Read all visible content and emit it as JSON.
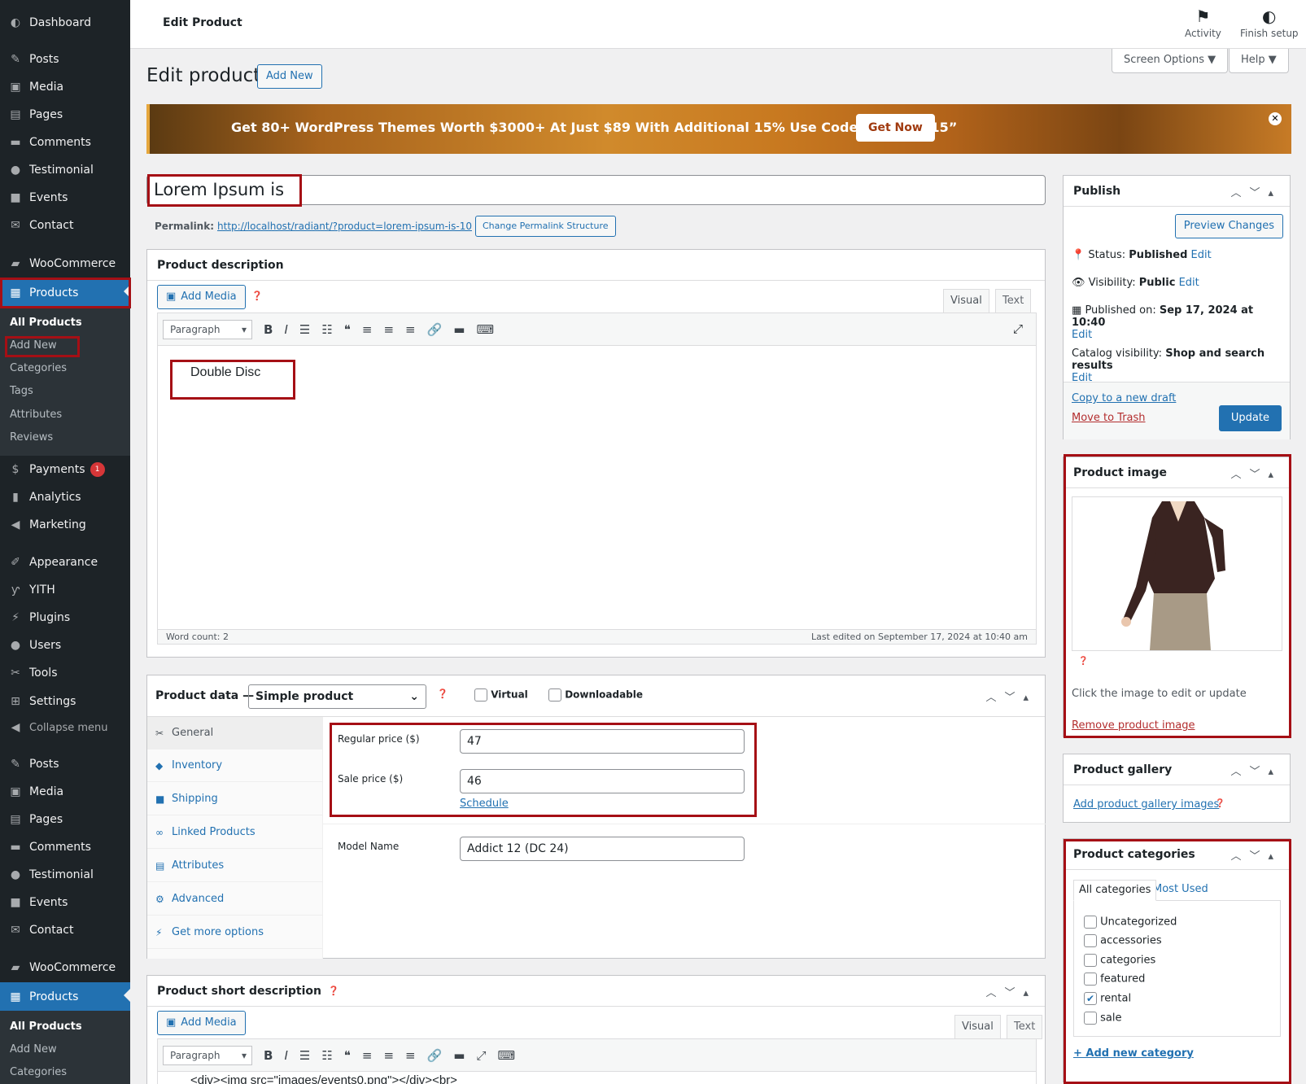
{
  "sidebar": {
    "items": [
      {
        "label": "Dashboard",
        "icon": "dashboard-icon"
      },
      {
        "label": "Posts",
        "icon": "pin-icon"
      },
      {
        "label": "Media",
        "icon": "media-icon"
      },
      {
        "label": "Pages",
        "icon": "pages-icon"
      },
      {
        "label": "Comments",
        "icon": "comments-icon"
      },
      {
        "label": "Testimonial",
        "icon": "user-icon"
      },
      {
        "label": "Events",
        "icon": "video-icon"
      },
      {
        "label": "Contact",
        "icon": "mail-icon"
      },
      {
        "label": "WooCommerce",
        "icon": "woo-icon"
      },
      {
        "label": "Products",
        "icon": "archive-icon"
      }
    ],
    "products_submenu": [
      "All Products",
      "Add New",
      "Categories",
      "Tags",
      "Attributes",
      "Reviews"
    ],
    "items2": [
      {
        "label": "Payments",
        "icon": "dollar-icon"
      },
      {
        "label": "Analytics",
        "icon": "chart-icon"
      },
      {
        "label": "Marketing",
        "icon": "megaphone-icon"
      },
      {
        "label": "Appearance",
        "icon": "brush-icon"
      },
      {
        "label": "YITH",
        "icon": "yith-icon"
      },
      {
        "label": "Plugins",
        "icon": "plug-icon"
      },
      {
        "label": "Users",
        "icon": "user-icon"
      },
      {
        "label": "Tools",
        "icon": "wrench-icon"
      },
      {
        "label": "Settings",
        "icon": "settings-icon"
      },
      {
        "label": "Collapse menu",
        "icon": "collapse-icon"
      },
      {
        "label": "Posts",
        "icon": "pin-icon"
      },
      {
        "label": "Media",
        "icon": "media-icon"
      },
      {
        "label": "Pages",
        "icon": "pages-icon"
      },
      {
        "label": "Comments",
        "icon": "comments-icon"
      },
      {
        "label": "Testimonial",
        "icon": "user-icon"
      },
      {
        "label": "Events",
        "icon": "video-icon"
      },
      {
        "label": "Contact",
        "icon": "mail-icon"
      },
      {
        "label": "WooCommerce",
        "icon": "woo-icon"
      },
      {
        "label": "Products",
        "icon": "archive-icon"
      }
    ],
    "payments_badge": "1",
    "products_submenu2": [
      "All Products",
      "Add New",
      "Categories"
    ]
  },
  "topbar": {
    "title": "Edit Product",
    "activity": "Activity",
    "finish_setup": "Finish setup"
  },
  "screen_options": "Screen Options ▼",
  "help": "Help ▼",
  "page_title": "Edit product",
  "add_new": "Add New",
  "promo": {
    "text": "Get 80+ WordPress Themes Worth $3000+ At Just $89 With Additional 15% Use Code “MagBun15”",
    "button": "Get Now"
  },
  "post_title": "Lorem Ipsum is",
  "permalink": {
    "label": "Permalink:",
    "url": "http://localhost/radiant/?product=lorem-ipsum-is-10",
    "button": "Change Permalink Structure"
  },
  "description": {
    "heading": "Product description",
    "add_media": "Add Media",
    "tab_visual": "Visual",
    "tab_text": "Text",
    "format": "Paragraph",
    "content": "Double Disc",
    "word_count": "Word count: 2",
    "last_edited": "Last edited on September 17, 2024 at 10:40 am"
  },
  "product_data": {
    "heading": "Product data —",
    "type": "Simple product",
    "virtual": "Virtual",
    "downloadable": "Downloadable",
    "tabs": [
      "General",
      "Inventory",
      "Shipping",
      "Linked Products",
      "Attributes",
      "Advanced",
      "Get more options"
    ],
    "regular_price_label": "Regular price ($)",
    "regular_price": "47",
    "sale_price_label": "Sale price ($)",
    "sale_price": "46",
    "schedule": "Schedule",
    "model_name_label": "Model Name",
    "model_name": "Addict 12 (DC 24)"
  },
  "short_description": {
    "heading": "Product short description",
    "add_media": "Add Media",
    "tab_visual": "Visual",
    "tab_text": "Text",
    "format": "Paragraph",
    "content": "<div><img src=\"images/events0.png\"></div><br>"
  },
  "publish": {
    "heading": "Publish",
    "preview": "Preview Changes",
    "status_label": "Status:",
    "status": "Published",
    "visibility_label": "Visibility:",
    "visibility": "Public",
    "published_label": "Published on:",
    "published": "Sep 17, 2024 at 10:40",
    "catalog_label": "Catalog visibility:",
    "catalog": "Shop and search results",
    "edit": "Edit",
    "copy": "Copy to a new draft",
    "trash": "Move to Trash",
    "update": "Update"
  },
  "product_image": {
    "heading": "Product image",
    "hint": "Click the image to edit or update",
    "remove": "Remove product image"
  },
  "gallery": {
    "heading": "Product gallery",
    "add": "Add product gallery images"
  },
  "categories": {
    "heading": "Product categories",
    "tab_all": "All categories",
    "tab_used": "Most Used",
    "items": [
      {
        "label": "Uncategorized",
        "checked": false
      },
      {
        "label": "accessories",
        "checked": false
      },
      {
        "label": "categories",
        "checked": false
      },
      {
        "label": "featured",
        "checked": false
      },
      {
        "label": "rental",
        "checked": true
      },
      {
        "label": "sale",
        "checked": false
      }
    ],
    "add": "+ Add new category"
  },
  "colors": {
    "accent": "#2271b1",
    "sidebar": "#1d2327",
    "highlight": "#a50f15"
  }
}
